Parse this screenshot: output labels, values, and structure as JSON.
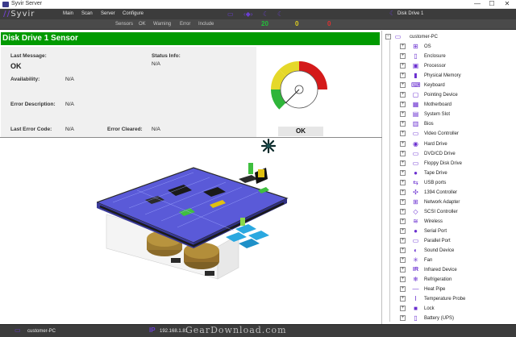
{
  "window": {
    "title": "Syvir Server",
    "minimize": "—",
    "maximize": "☐",
    "close": "✕"
  },
  "menu": {
    "logo": "Syvir",
    "items": [
      "Main",
      "Scan",
      "Server",
      "Configure"
    ],
    "device_title": "Disk Drive 1",
    "icons": [
      "monitor-icon",
      "code-brackets-icon",
      "moon-icon",
      "moon-icon"
    ]
  },
  "tabs": {
    "items": [
      "Sensors",
      "OK",
      "Warning",
      "Error",
      "Include"
    ],
    "counts": {
      "ok": "20",
      "warning": "0",
      "error": "0"
    },
    "colors": {
      "ok": "#22c03a",
      "warning": "#e0d020",
      "error": "#e03030"
    }
  },
  "sensor": {
    "title": "Disk Drive 1 Sensor",
    "last_message_label": "Last Message:",
    "last_message_value": "OK",
    "status_info_label": "Status Info:",
    "status_info_value": "N/A",
    "availability_label": "Availability:",
    "availability_value": "N/A",
    "error_description_label": "Error Description:",
    "error_description_value": "N/A",
    "last_error_code_label": "Last Error Code:",
    "last_error_code_value": "N/A",
    "error_cleared_label": "Error Cleared:",
    "error_cleared_value": "N/A",
    "gauge_status": "OK",
    "accent": "#009a00"
  },
  "tree": {
    "root": "customer-PC",
    "items": [
      {
        "label": "OS",
        "icon": "windows-icon"
      },
      {
        "label": "Enclosure",
        "icon": "enclosure-icon"
      },
      {
        "label": "Processor",
        "icon": "processor-icon"
      },
      {
        "label": "Physical Memory",
        "icon": "memory-icon"
      },
      {
        "label": "Keyboard",
        "icon": "keyboard-icon"
      },
      {
        "label": "Pointing Device",
        "icon": "mouse-icon"
      },
      {
        "label": "Motherboard",
        "icon": "motherboard-icon"
      },
      {
        "label": "System Slot",
        "icon": "slot-icon"
      },
      {
        "label": "Bios",
        "icon": "bios-icon"
      },
      {
        "label": "Video Controller",
        "icon": "video-icon"
      },
      {
        "label": "Hard Drive",
        "icon": "hard-drive-icon"
      },
      {
        "label": "DVD/CD Drive",
        "icon": "dvd-icon"
      },
      {
        "label": "Floppy Disk Drive",
        "icon": "floppy-icon"
      },
      {
        "label": "Tape Drive",
        "icon": "tape-icon"
      },
      {
        "label": "USB ports",
        "icon": "usb-icon"
      },
      {
        "label": "1394 Controller",
        "icon": "firewire-icon"
      },
      {
        "label": "Network Adapter",
        "icon": "network-icon"
      },
      {
        "label": "SCSI Controller",
        "icon": "scsi-icon"
      },
      {
        "label": "Wireless",
        "icon": "wireless-icon"
      },
      {
        "label": "Serial Port",
        "icon": "serial-icon"
      },
      {
        "label": "Parallel Port",
        "icon": "parallel-icon"
      },
      {
        "label": "Sound Device",
        "icon": "sound-icon"
      },
      {
        "label": "Fan",
        "icon": "fan-icon"
      },
      {
        "label": "Infrared Device",
        "icon": "infrared-icon"
      },
      {
        "label": "Refrigeration",
        "icon": "snowflake-icon"
      },
      {
        "label": "Heat Pipe",
        "icon": "heat-pipe-icon"
      },
      {
        "label": "Temperature Probe",
        "icon": "thermometer-icon"
      },
      {
        "label": "Lock",
        "icon": "lock-icon"
      },
      {
        "label": "Battery (UPS)",
        "icon": "battery-icon"
      }
    ]
  },
  "statusbar": {
    "pc": "customer-PC",
    "ip_label": "IP",
    "ip": "192.168.1.81"
  },
  "watermark": "GearDownload.com"
}
